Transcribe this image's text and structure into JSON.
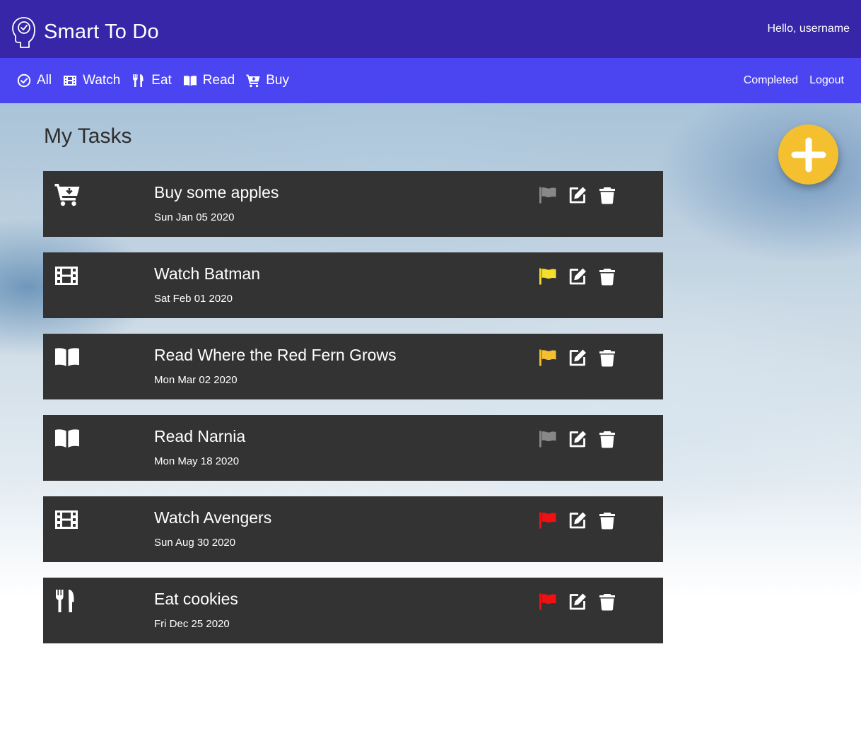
{
  "header": {
    "title": "Smart To Do",
    "greeting": "Hello, username"
  },
  "nav": {
    "categories": [
      {
        "label": "All",
        "icon": "check-circle-icon"
      },
      {
        "label": "Watch",
        "icon": "film-icon"
      },
      {
        "label": "Eat",
        "icon": "utensils-icon"
      },
      {
        "label": "Read",
        "icon": "book-icon"
      },
      {
        "label": "Buy",
        "icon": "cart-icon"
      }
    ],
    "completed": "Completed",
    "logout": "Logout"
  },
  "main": {
    "title": "My Tasks",
    "add_icon": "plus-icon"
  },
  "colors": {
    "topbar": "#3826a8",
    "navbar": "#4b45f1",
    "task_bg": "#333333",
    "add_button": "#f4c02f",
    "flag_none": "#888888",
    "flag_yellow": "#f5de2c",
    "flag_orange": "#f4c02f",
    "flag_red": "#ee1111"
  },
  "tasks": [
    {
      "category": "buy",
      "icon": "cart-icon",
      "title": "Buy some apples",
      "date": "Sun Jan 05 2020",
      "flag_color": "#888888"
    },
    {
      "category": "watch",
      "icon": "film-icon",
      "title": "Watch Batman",
      "date": "Sat Feb 01 2020",
      "flag_color": "#f5de2c"
    },
    {
      "category": "read",
      "icon": "book-icon",
      "title": "Read Where the Red Fern Grows",
      "date": "Mon Mar 02 2020",
      "flag_color": "#f4c02f"
    },
    {
      "category": "read",
      "icon": "book-icon",
      "title": "Read Narnia",
      "date": "Mon May 18 2020",
      "flag_color": "#888888"
    },
    {
      "category": "watch",
      "icon": "film-icon",
      "title": "Watch Avengers",
      "date": "Sun Aug 30 2020",
      "flag_color": "#ee1111"
    },
    {
      "category": "eat",
      "icon": "utensils-icon",
      "title": "Eat cookies",
      "date": "Fri Dec 25 2020",
      "flag_color": "#ee1111"
    }
  ]
}
